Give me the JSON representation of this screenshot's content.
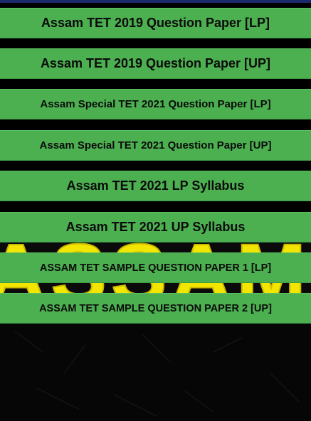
{
  "buttons": [
    {
      "label": "Assam TET 2019 Question Paper [LP]"
    },
    {
      "label": "Assam TET 2019 Question Paper [UP]"
    },
    {
      "label": "Assam Special TET 2021 Question Paper [LP]"
    },
    {
      "label": "Assam Special TET 2021 Question Paper [UP]"
    },
    {
      "label": "Assam TET 2021 LP Syllabus"
    },
    {
      "label": "Assam TET 2021 UP Syllabus"
    },
    {
      "label": "ASSAM TET SAMPLE QUESTION PAPER 1 [LP]"
    },
    {
      "label": "ASSAM TET SAMPLE QUESTION PAPER 2 [UP]"
    }
  ],
  "background": {
    "banner_text": "ASSAM TET",
    "banner_color": "#f2e600",
    "button_color": "#4caf50"
  }
}
